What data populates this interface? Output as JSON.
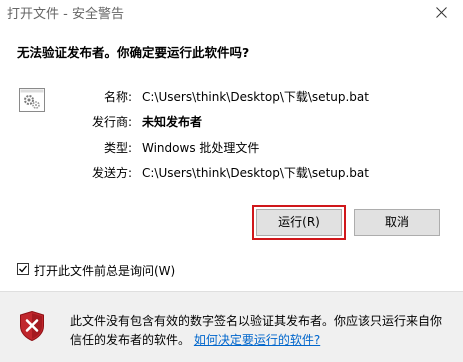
{
  "window": {
    "title": "打开文件 - 安全警告"
  },
  "question": "无法验证发布者。你确定要运行此软件吗?",
  "file_icon": "batch-file-gear-icon",
  "info": {
    "name_label": "名称:",
    "name_value": "C:\\Users\\think\\Desktop\\下载\\setup.bat",
    "publisher_label": "发行商:",
    "publisher_value": "未知发布者",
    "type_label": "类型:",
    "type_value": "Windows 批处理文件",
    "from_label": "发送方:",
    "from_value": "C:\\Users\\think\\Desktop\\下载\\setup.bat"
  },
  "buttons": {
    "run_label": "运行(R)",
    "cancel_label": "取消"
  },
  "checkbox": {
    "label": "打开此文件前总是询问(W)",
    "checked": true
  },
  "footer": {
    "warning_text": "此文件没有包含有效的数字签名以验证其发布者。你应该只运行来自你信任的发布者的软件。",
    "link_text": "如何决定要运行的软件?",
    "icon": "red-shield-x-icon"
  },
  "colors": {
    "highlight_border": "#d0171b",
    "link": "#0066cc",
    "footer_bg": "#f0f0f0",
    "button_bg": "#e1e1e1",
    "title_text": "#666666"
  }
}
